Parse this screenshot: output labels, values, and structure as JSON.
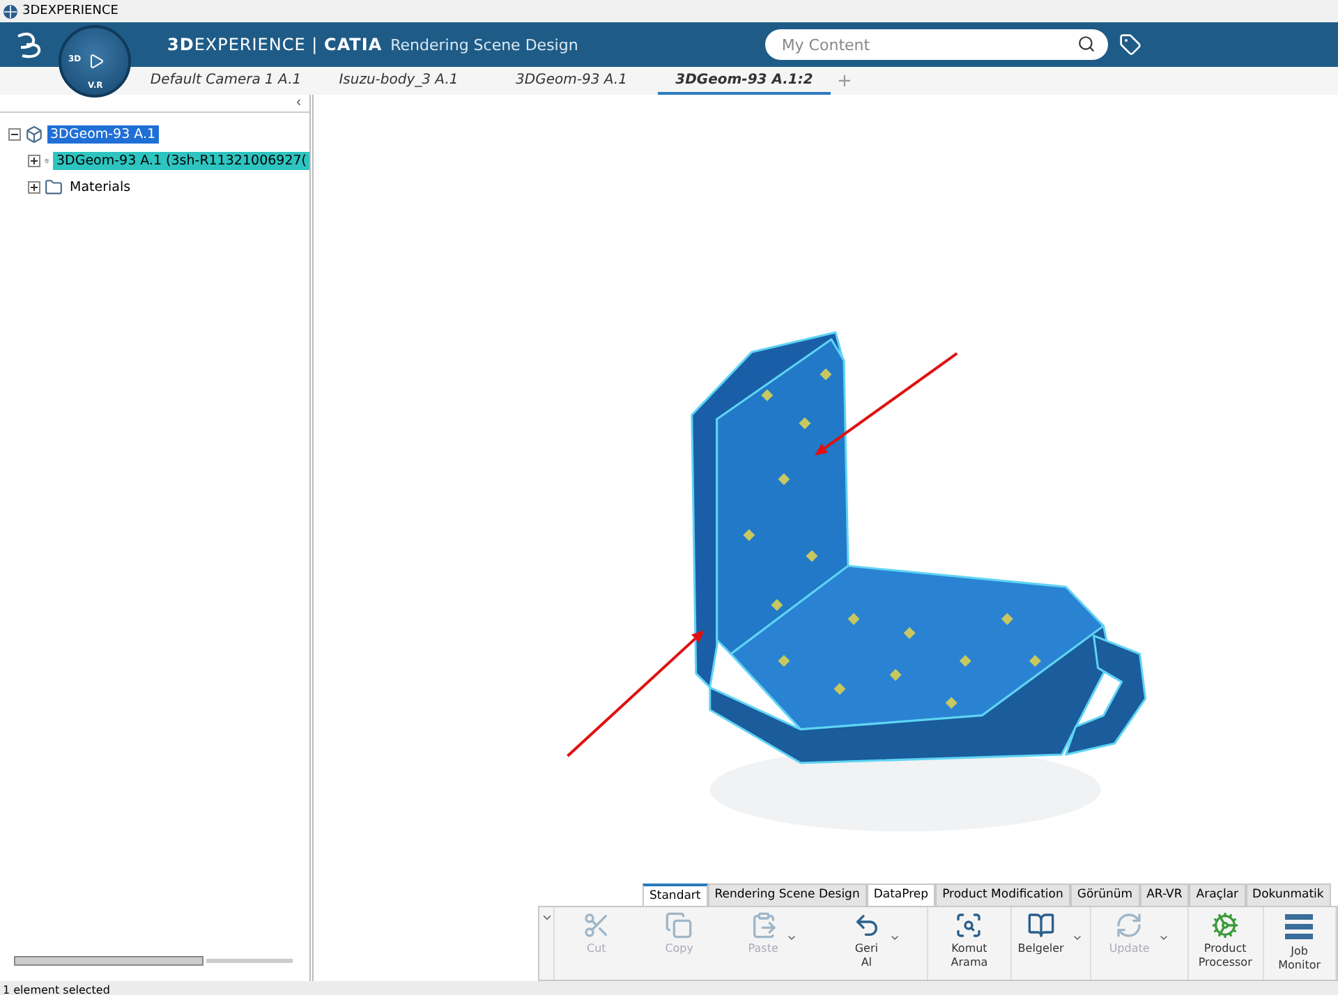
{
  "window": {
    "title": "3DEXPERIENCE"
  },
  "header": {
    "brand": "**3D**EXPERIENCE | **CATIA**",
    "app": "Rendering Scene Design",
    "compass": {
      "top_label": "3D",
      "bottom_label": "V.R"
    },
    "search": {
      "placeholder": "My Content"
    }
  },
  "tabs": [
    {
      "label": "Default Camera 1 A.1",
      "selected": false
    },
    {
      "label": "Isuzu-body_3 A.1",
      "selected": false
    },
    {
      "label": "3DGeom-93 A.1",
      "selected": false
    },
    {
      "label": "3DGeom-93 A.1:2",
      "selected": true
    }
  ],
  "new_tab": "+",
  "tree": {
    "collapse": "‹",
    "items": [
      {
        "label": "3DGeom-93 A.1",
        "expanded": true,
        "selected": true,
        "children": [
          {
            "label": "3DGeom-93 A.1 (3sh-R11321006927(",
            "expanded": false,
            "selected": false,
            "highlighted": true
          },
          {
            "label": "Materials",
            "expanded": false,
            "selected": false,
            "highlighted": false
          }
        ]
      }
    ]
  },
  "toolbar": {
    "tabs": [
      {
        "label": "Standart",
        "selected": true,
        "hovered": false
      },
      {
        "label": "Rendering Scene Design",
        "selected": false,
        "hovered": false
      },
      {
        "label": "DataPrep",
        "selected": false,
        "hovered": true
      },
      {
        "label": "Product Modification",
        "selected": false,
        "hovered": false
      },
      {
        "label": "Görünüm",
        "selected": false,
        "hovered": false
      },
      {
        "label": "AR-VR",
        "selected": false,
        "hovered": false
      },
      {
        "label": "Araçlar",
        "selected": false,
        "hovered": false
      },
      {
        "label": "Dokunmatik",
        "selected": false,
        "hovered": false
      }
    ],
    "groups": [
      {
        "buttons": [
          {
            "label": "Cut",
            "kind": "button",
            "disabled": true
          },
          {
            "label": "Copy",
            "kind": "button",
            "disabled": true
          },
          {
            "label": "Paste",
            "kind": "dropdown",
            "disabled": true
          },
          {
            "label": "Geri\nAl",
            "kind": "dropdown",
            "disabled": false
          }
        ]
      },
      {
        "buttons": [
          {
            "label": "Komut\nArama",
            "kind": "button",
            "disabled": false
          }
        ]
      },
      {
        "buttons": [
          {
            "label": "Belgeler",
            "kind": "dropdown",
            "disabled": false
          }
        ]
      },
      {
        "buttons": [
          {
            "label": "Update",
            "kind": "dropdown",
            "disabled": true
          }
        ]
      },
      {
        "buttons": [
          {
            "label": "Product\nProcessor",
            "kind": "button",
            "disabled": false
          }
        ]
      },
      {
        "buttons": [
          {
            "label": "Job\nMonitor",
            "kind": "button",
            "disabled": false
          }
        ]
      }
    ]
  },
  "status_bar": "1 element selected"
}
